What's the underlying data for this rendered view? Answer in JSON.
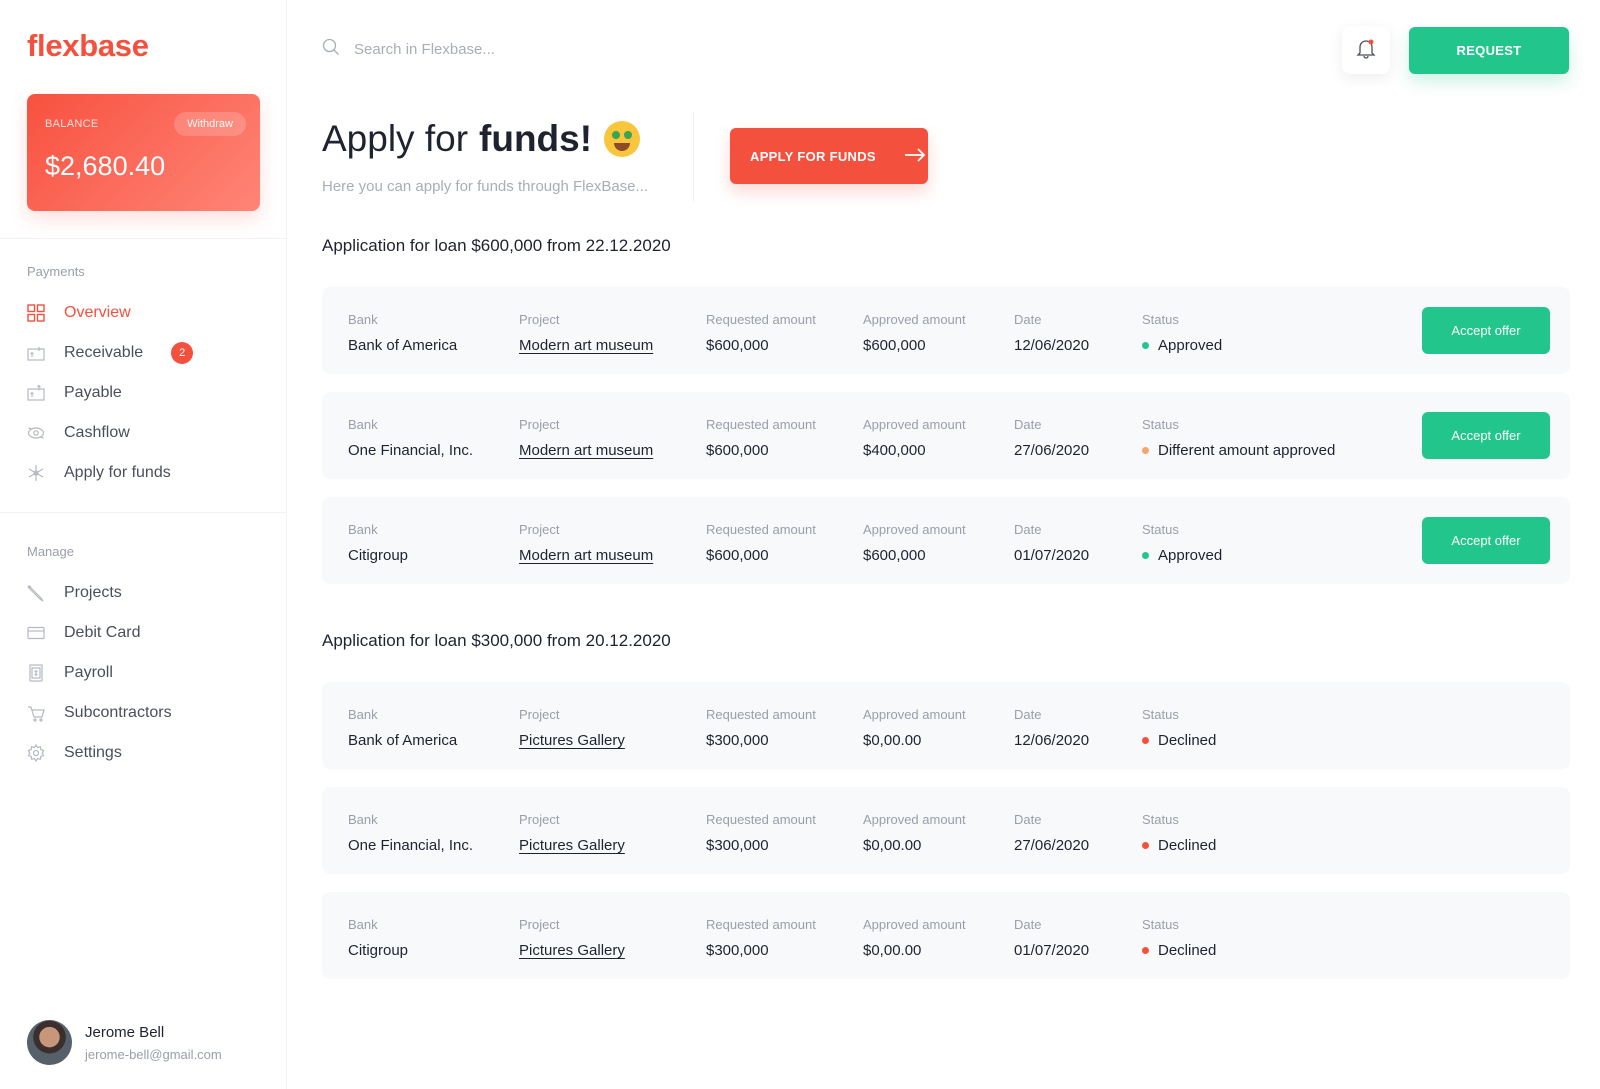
{
  "brand": {
    "name": "flexbase",
    "accent": "#f4503e",
    "success": "#22c58b"
  },
  "balance": {
    "label": "BALANCE",
    "withdraw": "Withdraw",
    "amount": "$2,680.40"
  },
  "sidebar": {
    "payments_title": "Payments",
    "payments": [
      {
        "label": "Overview",
        "icon": "grid-icon",
        "active": true
      },
      {
        "label": "Receivable",
        "icon": "receivable-icon",
        "badge": "2"
      },
      {
        "label": "Payable",
        "icon": "payable-icon"
      },
      {
        "label": "Cashflow",
        "icon": "cashflow-icon"
      },
      {
        "label": "Apply for funds",
        "icon": "snowflake-icon"
      }
    ],
    "manage_title": "Manage",
    "manage": [
      {
        "label": "Projects",
        "icon": "pen-icon"
      },
      {
        "label": "Debit Card",
        "icon": "card-icon"
      },
      {
        "label": "Payroll",
        "icon": "payroll-icon"
      },
      {
        "label": "Subcontractors",
        "icon": "cart-icon"
      },
      {
        "label": "Settings",
        "icon": "gear-icon"
      }
    ]
  },
  "user": {
    "name": "Jerome Bell",
    "email": "jerome-bell@gmail.com"
  },
  "search": {
    "placeholder": "Search in Flexbase..."
  },
  "topbar": {
    "request_label": "REQUEST"
  },
  "header": {
    "title_light": "Apply for",
    "title_bold": "funds!",
    "subtitle": "Here you can apply for funds through FlexBase...",
    "apply_label": "APPLY FOR FUNDS"
  },
  "columns": {
    "bank": "Bank",
    "project": "Project",
    "requested": "Requested amount",
    "approved": "Approved amount",
    "date": "Date",
    "status": "Status"
  },
  "accept_label": "Accept offer",
  "applications": [
    {
      "title": "Application for loan $600,000 from 22.12.2020",
      "rows": [
        {
          "bank": "Bank of America",
          "project": "Modern art museum",
          "requested": "$600,000",
          "approved": "$600,000",
          "date": "12/06/2020",
          "status": "Approved",
          "status_color": "#22c58b",
          "accept": true
        },
        {
          "bank": "One Financial, Inc.",
          "project": "Modern art museum",
          "requested": "$600,000",
          "approved": "$400,000",
          "date": "27/06/2020",
          "status": "Different amount approved",
          "status_color": "#f7a46a",
          "accept": true
        },
        {
          "bank": "Citigroup",
          "project": "Modern art museum",
          "requested": "$600,000",
          "approved": "$600,000",
          "date": "01/07/2020",
          "status": "Approved",
          "status_color": "#22c58b",
          "accept": true
        }
      ]
    },
    {
      "title": "Application for loan $300,000 from 20.12.2020",
      "rows": [
        {
          "bank": "Bank of America",
          "project": "Pictures Gallery",
          "requested": "$300,000",
          "approved": "$0,00.00",
          "date": "12/06/2020",
          "status": "Declined",
          "status_color": "#f4503e",
          "accept": false
        },
        {
          "bank": "One Financial, Inc.",
          "project": "Pictures Gallery",
          "requested": "$300,000",
          "approved": "$0,00.00",
          "date": "27/06/2020",
          "status": "Declined",
          "status_color": "#f4503e",
          "accept": false
        },
        {
          "bank": "Citigroup",
          "project": "Pictures Gallery",
          "requested": "$300,000",
          "approved": "$0,00.00",
          "date": "01/07/2020",
          "status": "Declined",
          "status_color": "#f4503e",
          "accept": false
        }
      ]
    }
  ]
}
